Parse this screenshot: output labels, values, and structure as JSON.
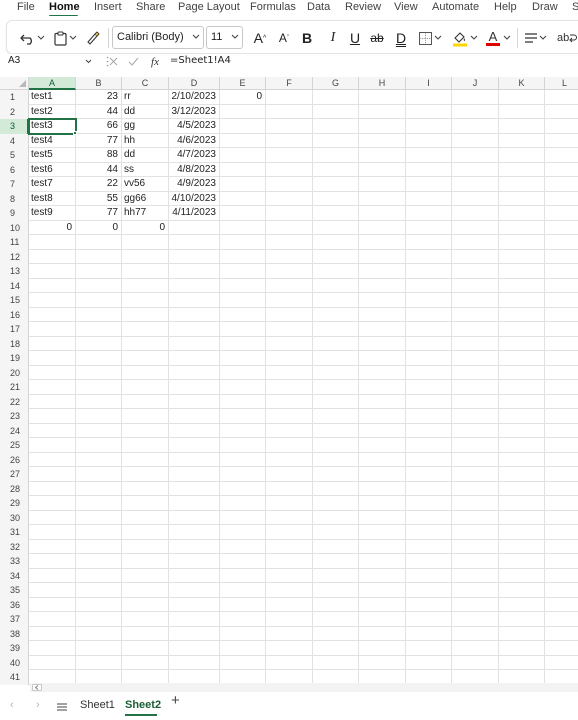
{
  "menu": {
    "tabs": [
      "File",
      "Home",
      "Insert",
      "Share",
      "Page Layout",
      "Formulas",
      "Data",
      "Review",
      "View",
      "Automate",
      "Help",
      "Draw",
      "S"
    ],
    "active": "Home"
  },
  "ribbon": {
    "font_name": "Calibri (Body)",
    "font_size": "11",
    "grow_font": "A",
    "shrink_font": "A",
    "bold": "B",
    "italic": "I",
    "underline": "U",
    "strikethrough": "ab",
    "double_underline": "D",
    "font_color_letter": "A",
    "wrap_text": "ab",
    "highlight_color": "#ffd600",
    "font_color": "#e00000"
  },
  "formula_bar": {
    "name_box": "A3",
    "fx": "fx",
    "formula": "=Sheet1!A4"
  },
  "sheet": {
    "columns": [
      "A",
      "B",
      "C",
      "D",
      "E",
      "F",
      "G",
      "H",
      "I",
      "J",
      "K",
      "L"
    ],
    "selected_column": "A",
    "selected_row": 3,
    "row_count": 41,
    "rows": [
      [
        "test1",
        "23",
        "rr",
        "2/10/2023",
        "0"
      ],
      [
        "test2",
        "44",
        "dd",
        "3/12/2023",
        ""
      ],
      [
        "test3",
        "66",
        "gg",
        "4/5/2023",
        ""
      ],
      [
        "test4",
        "77",
        "hh",
        "4/6/2023",
        ""
      ],
      [
        "test5",
        "88",
        "dd",
        "4/7/2023",
        ""
      ],
      [
        "test6",
        "44",
        "ss",
        "4/8/2023",
        ""
      ],
      [
        "test7",
        "22",
        "vv56",
        "4/9/2023",
        ""
      ],
      [
        "test8",
        "55",
        "gg66",
        "4/10/2023",
        ""
      ],
      [
        "test9",
        "77",
        "hh77",
        "4/11/2023",
        ""
      ],
      [
        "0",
        "0",
        "0",
        "",
        ""
      ]
    ]
  },
  "sheet_tabs": {
    "tabs": [
      "Sheet1",
      "Sheet2"
    ],
    "active": "Sheet2",
    "add": "+"
  },
  "colors": {
    "accent": "#217346",
    "selected_header": "#d3ead9"
  }
}
